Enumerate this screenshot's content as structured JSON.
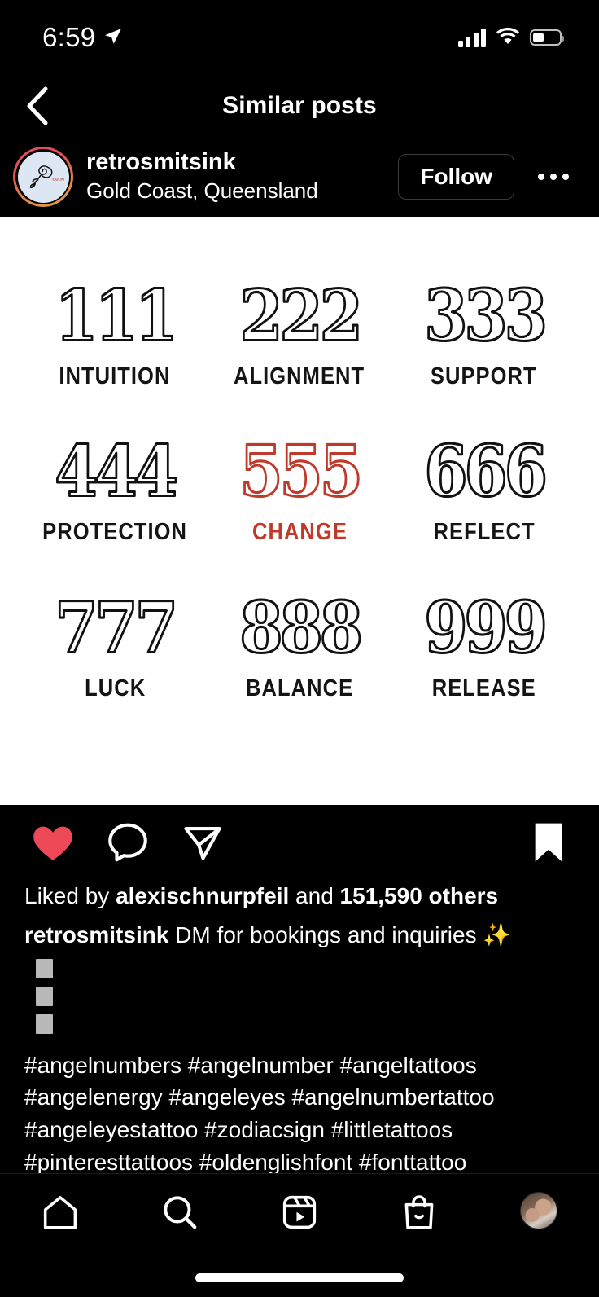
{
  "status_bar": {
    "time": "6:59",
    "location_icon": "location-arrow-icon",
    "signal_icon": "cellular-signal-icon",
    "wifi_icon": "wifi-icon",
    "battery_icon": "battery-icon",
    "battery_level_percent": 42
  },
  "nav_header": {
    "back_icon": "chevron-left-icon",
    "title": "Similar posts"
  },
  "post_header": {
    "avatar_name": "retrosmitsink-avatar",
    "username": "retrosmitsink",
    "location": "Gold Coast, Queensland",
    "follow_label": "Follow",
    "more_icon": "more-options-icon"
  },
  "media": {
    "background_color": "#ffffff",
    "ink_color": "#111111",
    "accent_color": "#bf3a2b",
    "items": [
      {
        "number": "111",
        "label": "INTUITION",
        "color": "black"
      },
      {
        "number": "222",
        "label": "ALIGNMENT",
        "color": "black"
      },
      {
        "number": "333",
        "label": "SUPPORT",
        "color": "black"
      },
      {
        "number": "444",
        "label": "PROTECTION",
        "color": "black"
      },
      {
        "number": "555",
        "label": "CHANGE",
        "color": "red"
      },
      {
        "number": "666",
        "label": "REFLECT",
        "color": "black"
      },
      {
        "number": "777",
        "label": "LUCK",
        "color": "black"
      },
      {
        "number": "888",
        "label": "BALANCE",
        "color": "black"
      },
      {
        "number": "999",
        "label": "RELEASE",
        "color": "black"
      }
    ]
  },
  "actions": {
    "like_icon": "heart-filled-icon",
    "like_color": "#ed4956",
    "comment_icon": "comment-icon",
    "share_icon": "share-icon",
    "save_icon": "bookmark-filled-icon"
  },
  "caption_block": {
    "likes_prefix": "Liked by ",
    "likes_username": "alexischnurpfeil",
    "likes_middle": " and ",
    "likes_count": "151,590 others",
    "caption_username": "retrosmitsink",
    "caption_text": " DM for bookings and inquiries ",
    "caption_emoji": "✨",
    "placeholder_glyph_count": 3,
    "hashtags": "#angelnumbers #angelnumber #angeltattoos\n#angelenergy #angeleyes #angelnumbertattoo\n#angeleyestattoo #zodiacsign #littletattoos\n#pinteresttattoos #oldenglishfont #fonttattoo\n#linearttattoos #pinteresttattoos #cutetatts"
  },
  "tab_bar": {
    "items": [
      {
        "name": "home-tab",
        "icon": "home-icon"
      },
      {
        "name": "search-tab",
        "icon": "search-icon"
      },
      {
        "name": "reels-tab",
        "icon": "reels-icon"
      },
      {
        "name": "shop-tab",
        "icon": "shop-bag-icon"
      },
      {
        "name": "profile-tab",
        "icon": "profile-avatar-icon"
      }
    ]
  }
}
